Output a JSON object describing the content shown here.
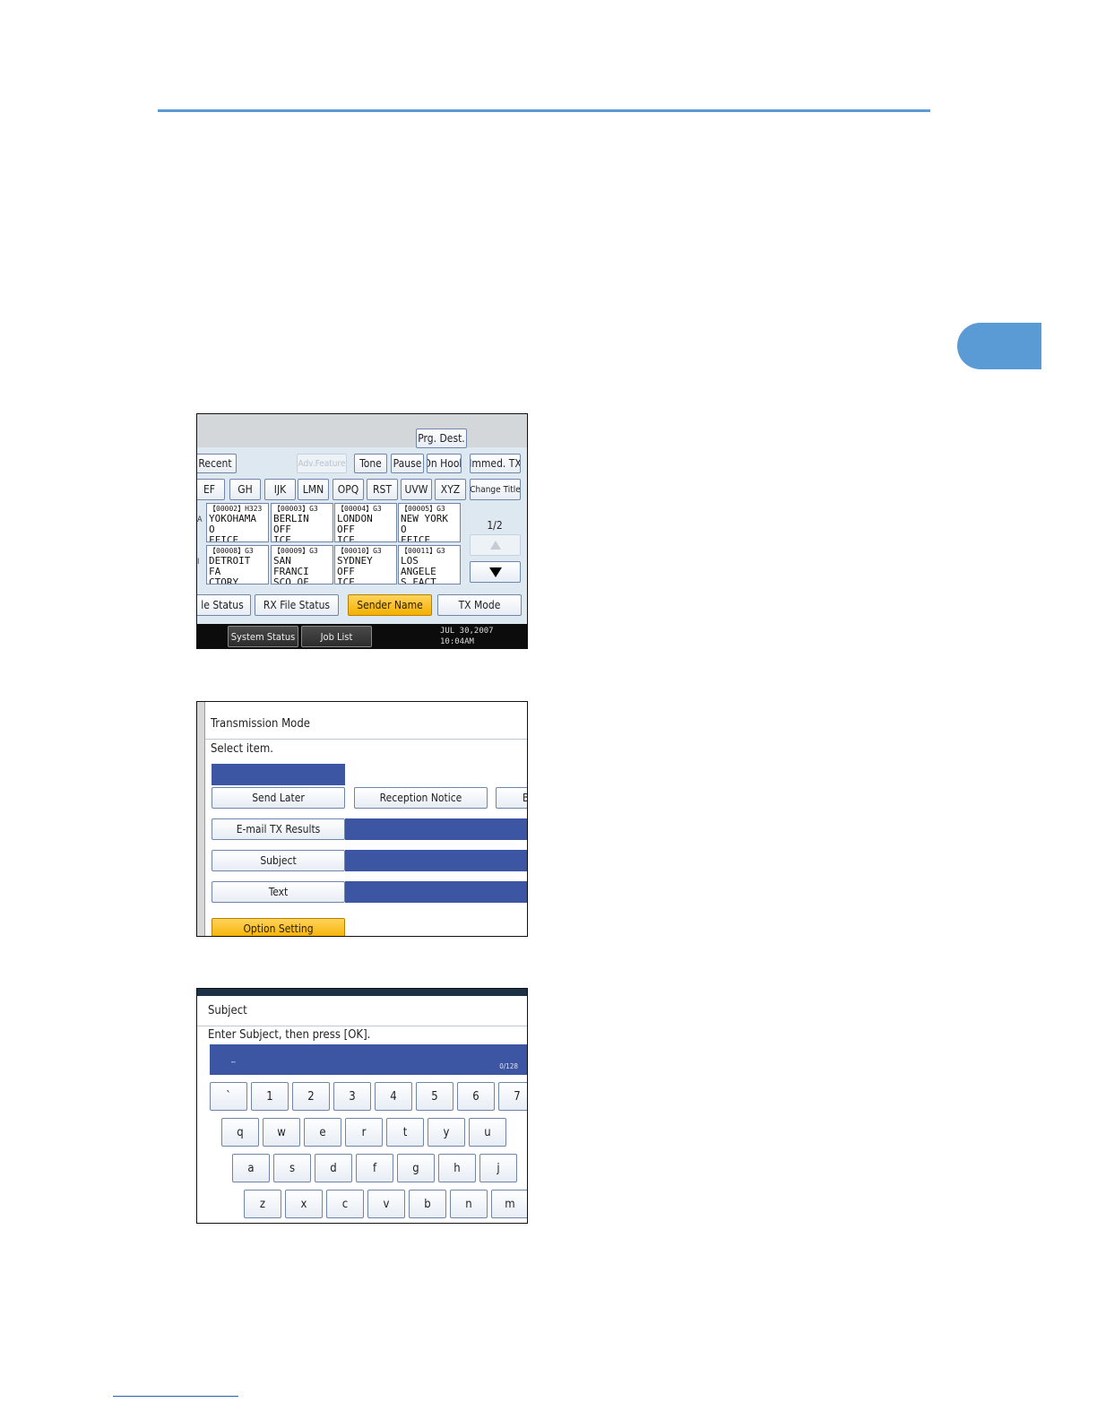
{
  "screen1": {
    "prg_dest": "Prg. Dest.",
    "recent": "Recent",
    "adv_features": "Adv.Feature",
    "tone": "Tone",
    "pause": "Pause",
    "on_hook": "On Hook",
    "immed_tx": "Immed. TX",
    "alpha_tabs": [
      "EF",
      "GH",
      "IJK",
      "LMN",
      "OPQ",
      "RST",
      "UVW",
      "XYZ"
    ],
    "change_title": "Change Title",
    "row1_edge": "A",
    "row2_edge": "I",
    "destinations": [
      {
        "header": "【00002】H323",
        "line1": "YOKOHAMA O",
        "line2": "FFICE"
      },
      {
        "header": "【00003】G3",
        "line1": "BERLIN OFF",
        "line2": "ICE"
      },
      {
        "header": "【00004】G3",
        "line1": "LONDON OFF",
        "line2": "ICE"
      },
      {
        "header": "【00005】G3",
        "line1": "NEW YORK O",
        "line2": "FFICE"
      },
      {
        "header": "【00008】G3",
        "line1": "DETROIT FA",
        "line2": "CTORY"
      },
      {
        "header": "【00009】G3",
        "line1": "SAN FRANCI",
        "line2": "SCO OF"
      },
      {
        "header": "【00010】G3",
        "line1": "SYDNEY OFF",
        "line2": "ICE"
      },
      {
        "header": "【00011】G3",
        "line1": "LOS ANGELE",
        "line2": "S FACT"
      }
    ],
    "page": "1/2",
    "file_status": "le Status",
    "rx_file_status": "RX File Status",
    "sender_name": "Sender Name",
    "tx_mode": "TX Mode",
    "system_status": "System Status",
    "job_list": "Job List",
    "date": "JUL   30,2007",
    "time": "10:04AM"
  },
  "screen2": {
    "title": "Transmission Mode",
    "prompt": "Select item.",
    "send_later": "Send Later",
    "reception_notice": "Reception Notice",
    "cut_button": "B",
    "email_tx_results": "E-mail TX Results",
    "subject": "Subject",
    "text": "Text",
    "option_setting": "Option Setting"
  },
  "screen3": {
    "title": "Subject",
    "prompt": "Enter Subject, then press [OK].",
    "cursor": "_",
    "counter": "0/128",
    "row1": [
      "`",
      "1",
      "2",
      "3",
      "4",
      "5",
      "6",
      "7"
    ],
    "row2": [
      "q",
      "w",
      "e",
      "r",
      "t",
      "y",
      "u"
    ],
    "row3": [
      "a",
      "s",
      "d",
      "f",
      "g",
      "h",
      "j"
    ],
    "row4": [
      "z",
      "x",
      "c",
      "v",
      "b",
      "n",
      "m"
    ]
  },
  "colors": {
    "accent_blue": "#5b9bd5",
    "navy_field": "#3d56a4",
    "highlight_orange": "#f4b000"
  }
}
